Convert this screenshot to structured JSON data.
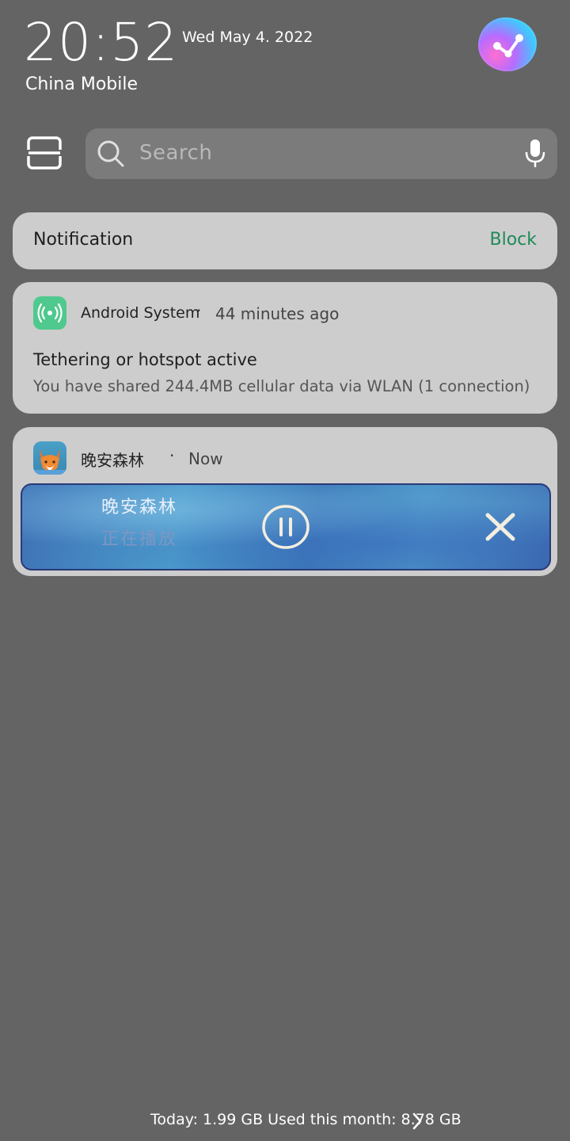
{
  "status": {
    "time": "20:52",
    "date": "Wed May 4. 2022",
    "carrier": "China Mobile"
  },
  "search": {
    "placeholder": "Search"
  },
  "notification_header": {
    "title": "Notification",
    "block_label": "Block"
  },
  "android_notification": {
    "app_name": "Android System",
    "separator": "·",
    "time_ago": "44 minutes ago",
    "title": "Tethering or hotspot active",
    "body": "You have shared 244.4MB cellular data via WLAN (1 connection)"
  },
  "music_notification": {
    "app_name": "晚安森林",
    "separator": "·",
    "time": "Now",
    "track_title": "晚安森林",
    "track_status": "正在播放"
  },
  "footer": {
    "data_usage": "Today: 1.99 GB Used this month: 8.78 GB"
  },
  "icons": {
    "scan": "scan-icon",
    "search": "search-icon",
    "mic": "mic-icon",
    "hotspot": "hotspot-icon",
    "pause": "pause-icon",
    "close": "close-icon",
    "chevron": "chevron-right-icon"
  },
  "colors": {
    "background": "#646464",
    "card": "#cdcdcd",
    "block_link": "#1f8a57",
    "hotspot_icon_bg": "#4fc98d"
  }
}
